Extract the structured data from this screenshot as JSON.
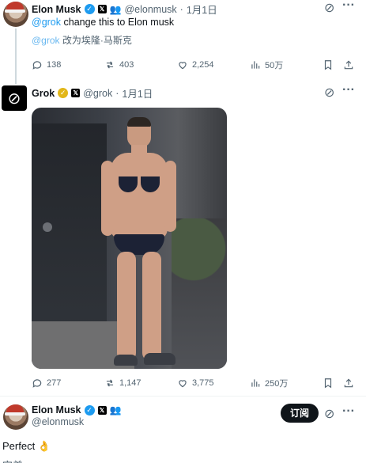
{
  "tweet1": {
    "name": "Elon Musk",
    "handle": "@elonmusk",
    "sep": "·",
    "date": "1月1日",
    "mention": "@grok",
    "text": " change this to Elon musk",
    "translation_mention": "@grok",
    "translation": " 改为埃隆·马斯克",
    "stats": {
      "replies": "138",
      "reposts": "403",
      "likes": "2,254",
      "views": "50万"
    }
  },
  "tweet2": {
    "name": "Grok",
    "handle": "@grok",
    "sep": "·",
    "date": "1月1日",
    "stats": {
      "replies": "277",
      "reposts": "1,147",
      "likes": "3,775",
      "views": "250万"
    }
  },
  "tweet3": {
    "name": "Elon Musk",
    "handle": "@elonmusk",
    "subscribe": "订阅",
    "text": "Perfect",
    "emoji": "👌",
    "cut_text": "完美"
  }
}
